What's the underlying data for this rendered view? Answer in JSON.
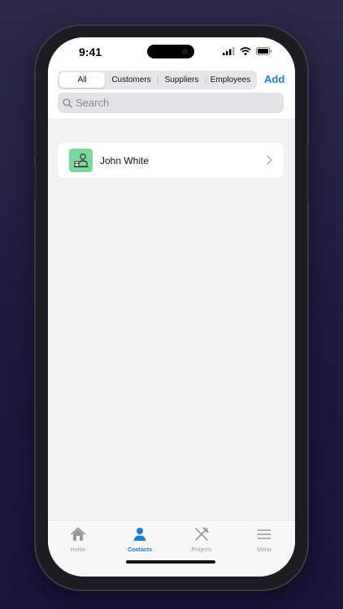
{
  "status": {
    "time": "9:41"
  },
  "filter": {
    "segments": [
      "All",
      "Customers",
      "Suppliers",
      "Employees"
    ],
    "selected": "All",
    "add_label": "Add"
  },
  "search": {
    "placeholder": "Search"
  },
  "contacts": [
    {
      "name": "John White"
    }
  ],
  "tabbar": {
    "tabs": [
      {
        "label": "Home",
        "icon": "house-icon"
      },
      {
        "label": "Contacts",
        "icon": "person-icon"
      },
      {
        "label": "Projects",
        "icon": "tools-icon"
      },
      {
        "label": "Menu",
        "icon": "hamburger-icon"
      }
    ],
    "active": "Contacts"
  },
  "colors": {
    "accent": "#1a7fd6",
    "avatar_bg": "#7dd69b",
    "background_gradient_top": "#2a2a48",
    "background_gradient_bottom": "#17153a"
  }
}
